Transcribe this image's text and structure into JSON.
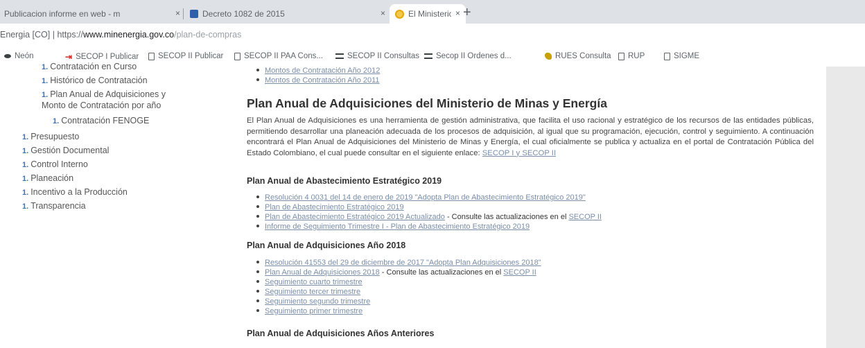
{
  "browser": {
    "tabs": [
      {
        "title": "Publicacion informe en web - m",
        "active": false
      },
      {
        "title": "Decreto 1082 de 2015",
        "active": false
      },
      {
        "title": "El Ministerio - Ministerio de Min",
        "active": true
      }
    ],
    "new_tab": "+",
    "close_glyph": "×",
    "address": {
      "site_label": "Energia [CO]",
      "separator": "|",
      "scheme": "https://",
      "host": "www.minenergia.gov.co",
      "path": "/plan-de-compras"
    },
    "bookmarks": [
      {
        "label": "Neón",
        "icon": "neon-icon"
      },
      {
        "label": "SECOP I Publicar",
        "icon": "secop-icon"
      },
      {
        "label": "SECOP II Publicar",
        "icon": "page-icon"
      },
      {
        "label": "SECOP II PAA Cons...",
        "icon": "page-icon"
      },
      {
        "label": "SECOP II Consultas",
        "icon": "bars-icon"
      },
      {
        "label": "Secop II Ordenes d...",
        "icon": "bars-icon"
      },
      {
        "label": "RUES Consulta",
        "icon": "bird-icon"
      },
      {
        "label": "RUP",
        "icon": "page-icon"
      },
      {
        "label": "SIGME",
        "icon": "page-icon"
      }
    ]
  },
  "sidebar": {
    "bullet": "1.",
    "items": [
      {
        "label": "Contratación en Curso"
      },
      {
        "label": "Histórico de Contratación"
      },
      {
        "label": "Plan Anual de Adquisiciones y"
      },
      {
        "label": "Monto de Contratación por año"
      },
      {
        "label": "Contratación FENOGE"
      },
      {
        "label": "Presupuesto"
      },
      {
        "label": "Gestión Documental"
      },
      {
        "label": "Control Interno"
      },
      {
        "label": "Planeación"
      },
      {
        "label": "Incentivo a la Producción"
      },
      {
        "label": "Transparencia"
      }
    ]
  },
  "main": {
    "top_links": [
      "Montos de Contratación Año 2012",
      "Montos de Contratación Año 2011"
    ],
    "heading": "Plan Anual de Adquisiciones del Ministerio de Minas y Energía",
    "paragraph": "El Plan Anual de Adquisiciones es una herramienta de gestión administrativa, que facilita el uso racional y estratégico de los recursos de las entidades públicas, permitiendo desarrollar una planeación adecuada de los procesos de adquisición, al igual que su programación, ejecución, control y seguimiento. A continuación encontrará el Plan Anual de Adquisiciones del Ministerio de Minas y Energía, el cual oficialmente se publica y actualiza en el portal de Contratación Pública del Estado Colombiano, el cual puede consultar en el siguiente enlace:",
    "paragraph_link": "SECOP I y SECOP II",
    "section_2019": {
      "title": "Plan Anual de Abastecimiento Estratégico 2019",
      "items": [
        {
          "link": "Resolución 4 0031 del 14 de enero de 2019 \"Adopta Plan de Abastecimiento Estratégico 2019\"",
          "suffix": "",
          "suffix_link": ""
        },
        {
          "link": "Plan de Abastecimiento Estratégico 2019",
          "suffix": "",
          "suffix_link": ""
        },
        {
          "link": "Plan de Abastecimiento Estratégico 2019 Actualizado",
          "suffix": " - Consulte las actualizaciones en el ",
          "suffix_link": "SECOP II"
        },
        {
          "link": "Informe de Seguimiento Trimestre I - Plan de Abastecimiento Estratégico 2019",
          "suffix": "",
          "suffix_link": ""
        }
      ]
    },
    "section_2018": {
      "title": "Plan Anual de Adquisiciones Año 2018",
      "items": [
        {
          "link": "Resolución 41553 del 29 de diciembre de 2017 \"Adopta Plan Adquisiciones 2018\"",
          "suffix": "",
          "suffix_link": ""
        },
        {
          "link": "Plan Anual de Adquisiciones 2018",
          "suffix": " - Consulte las actualizaciones en el ",
          "suffix_link": "SECOP II"
        },
        {
          "link": "Seguimiento cuarto trimestre",
          "suffix": "",
          "suffix_link": ""
        },
        {
          "link": "Seguimiento tercer trimestre",
          "suffix": "",
          "suffix_link": ""
        },
        {
          "link": "Seguimiento segundo trimestre",
          "suffix": "",
          "suffix_link": ""
        },
        {
          "link": "Seguimiento primer trimestre",
          "suffix": "",
          "suffix_link": ""
        }
      ]
    },
    "section_prev": {
      "title": "Plan Anual de Adquisiciones Años Anteriores"
    }
  },
  "colors": {
    "link": "#7a8ea8",
    "bullet": "#3b73b9",
    "tabbar": "#dee1e6"
  }
}
